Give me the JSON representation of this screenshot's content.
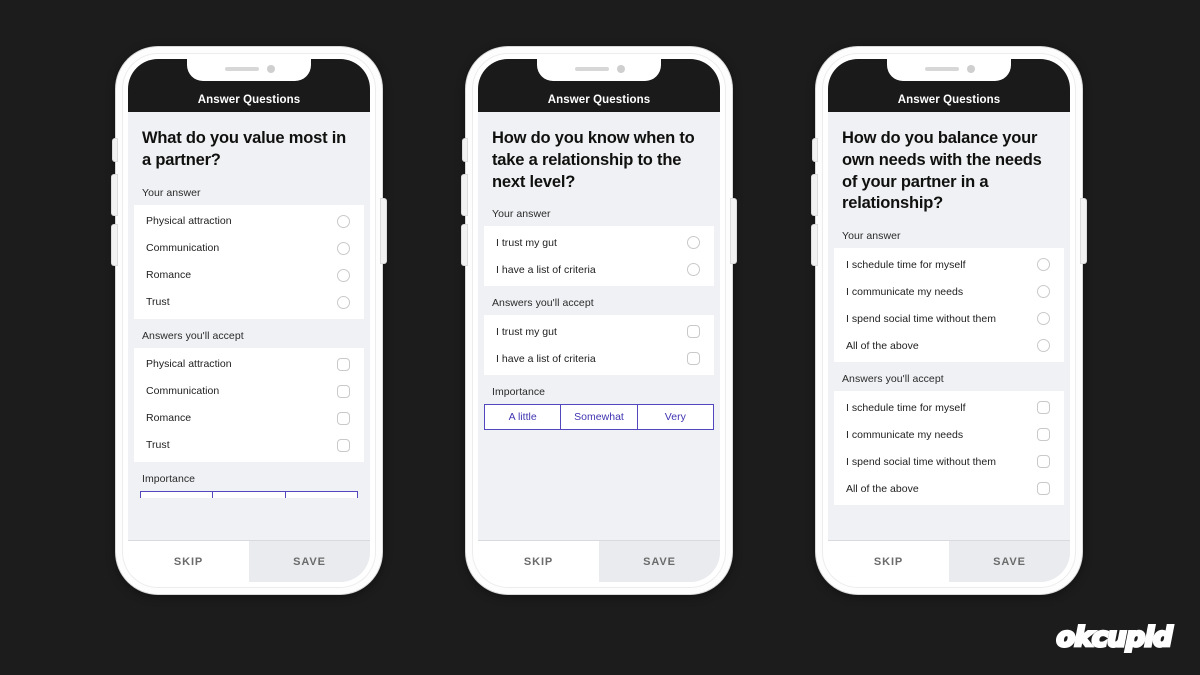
{
  "canvas": {
    "background_color": "#1c1c1c",
    "brand_logo": "okcupid"
  },
  "theme": {
    "navbar_color": "#1a1a1a",
    "screen_background": "#eff1f4",
    "card_color": "#ffffff",
    "accent_color": "#3f34b0",
    "control_border_color": "#5247bd",
    "save_button_background": "#e9ebee"
  },
  "shared": {
    "navbar_title": "Answer Questions",
    "your_answer_label": "Your answer",
    "answers_accept_label": "Answers you'll accept",
    "importance_label": "Importance",
    "importance_options": [
      "A little",
      "Somewhat",
      "Very"
    ],
    "skip_label": "SKIP",
    "save_label": "SAVE"
  },
  "phones": [
    {
      "id": "phone-1",
      "question": "What do you value most in a partner?",
      "your_answer_options": [
        "Physical attraction",
        "Communication",
        "Romance",
        "Trust"
      ],
      "answers_accept_options": [
        "Physical attraction",
        "Communication",
        "Romance",
        "Trust"
      ],
      "importance_visible": "partial"
    },
    {
      "id": "phone-2",
      "question": "How do you know when to take a relationship to the next level?",
      "your_answer_options": [
        "I trust my gut",
        "I have a list of criteria"
      ],
      "answers_accept_options": [
        "I trust my gut",
        "I have a list of criteria"
      ],
      "importance_visible": "full"
    },
    {
      "id": "phone-3",
      "question": "How do you balance your own needs with the needs of your partner in a relationship?",
      "your_answer_options": [
        "I schedule time for myself",
        "I communicate my needs",
        "I spend social time without them",
        "All of the above"
      ],
      "answers_accept_options": [
        "I schedule time for myself",
        "I communicate my needs",
        "I spend social time without them",
        "All of the above"
      ],
      "importance_visible": "none"
    }
  ]
}
